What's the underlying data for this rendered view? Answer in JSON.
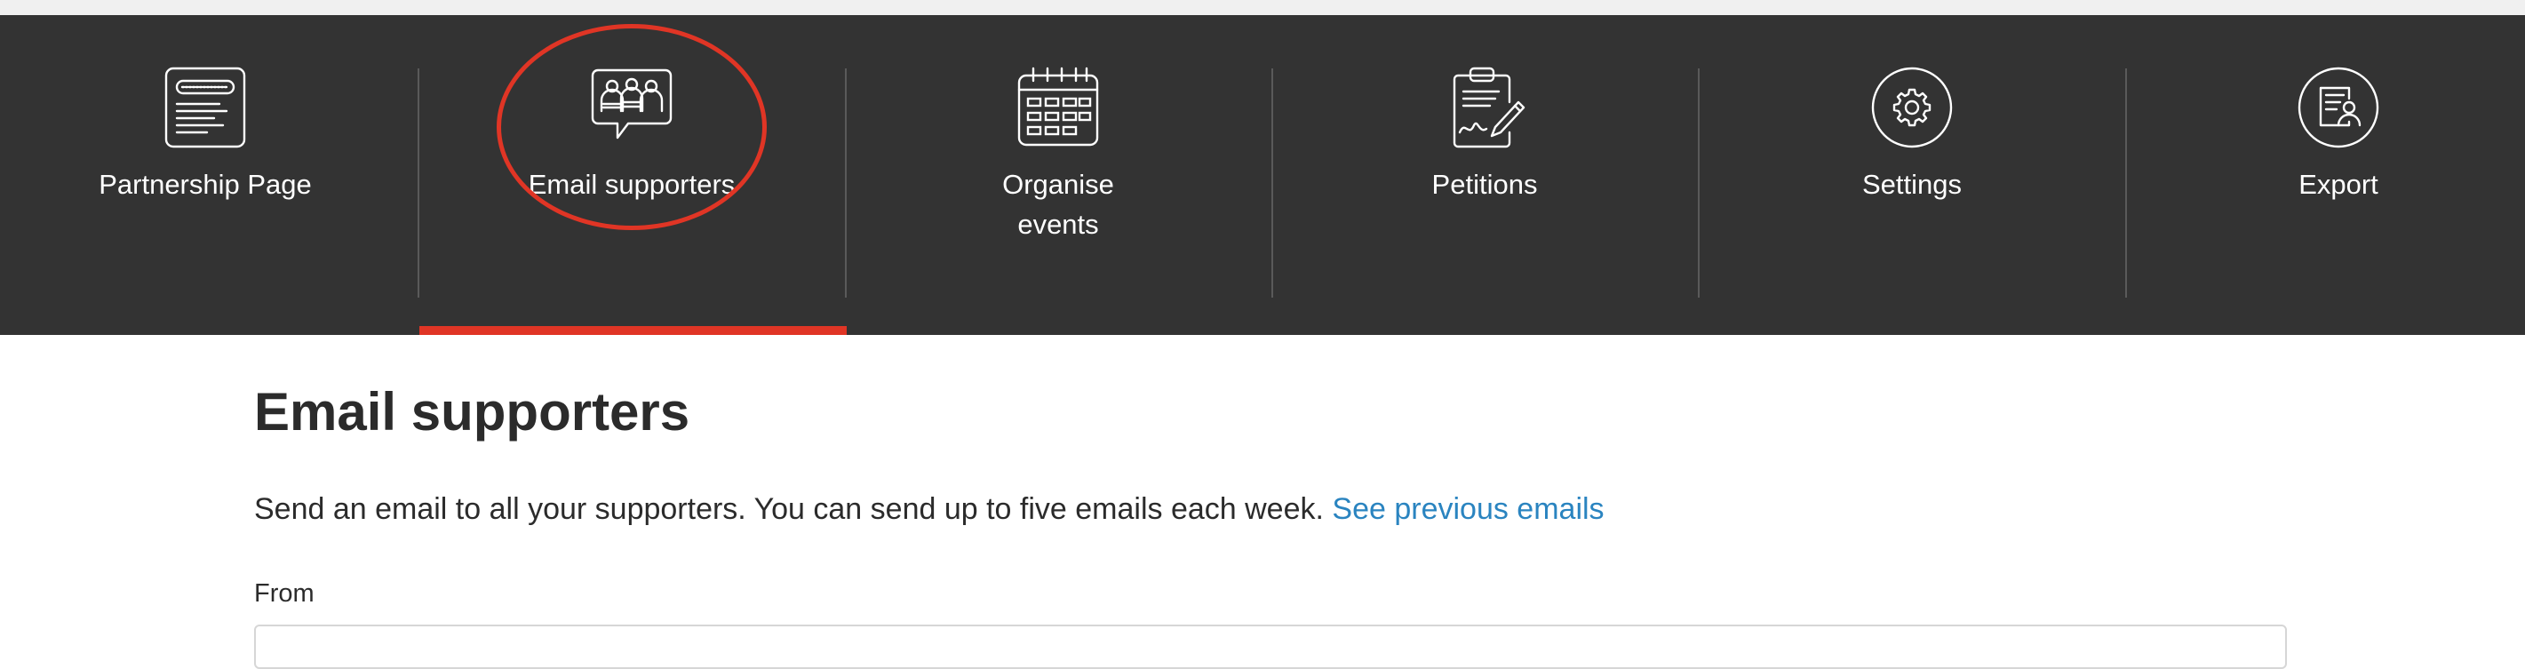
{
  "nav": {
    "items": [
      {
        "label": "Partnership Page",
        "icon": "partnership-page-icon"
      },
      {
        "label": "Email supporters",
        "icon": "email-supporters-icon",
        "active": true
      },
      {
        "label": "Organise\nevents",
        "icon": "calendar-icon"
      },
      {
        "label": "Petitions",
        "icon": "petition-clipboard-icon"
      },
      {
        "label": "Settings",
        "icon": "gear-icon"
      },
      {
        "label": "Export",
        "icon": "export-icon"
      }
    ]
  },
  "main": {
    "title": "Email supporters",
    "intro": "Send an email to all your supporters. You can send up to five emails each week. ",
    "intro_link": "See previous emails",
    "from_label": "From"
  },
  "colors": {
    "nav_background": "#333333",
    "accent_red": "#e03525",
    "link_blue": "#2a84c0"
  }
}
